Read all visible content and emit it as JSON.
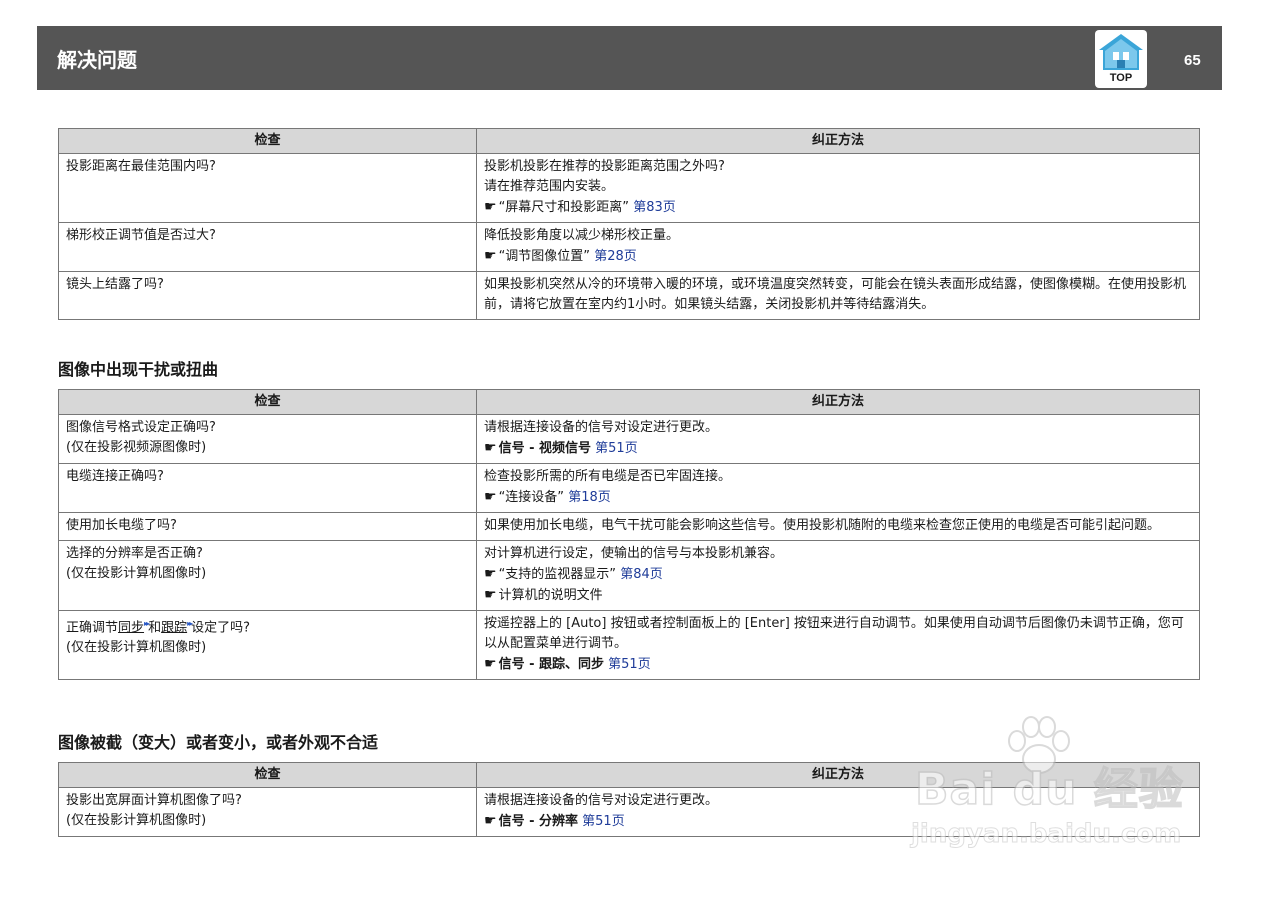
{
  "header": {
    "title": "解决问题",
    "top_label": "TOP",
    "page_number": "65"
  },
  "common": {
    "col_check": "检查",
    "col_fix": "纠正方法"
  },
  "table1": {
    "rows": [
      {
        "check": [
          "投影距离在最佳范围内吗?"
        ],
        "fix": [
          "投影机投影在推荐的投影距离范围之外吗?",
          "请在推荐范围内安装。"
        ],
        "refs": [
          {
            "text": "“屏幕尺寸和投影距离”",
            "page": "第83页"
          }
        ]
      },
      {
        "check": [
          "梯形校正调节值是否过大?"
        ],
        "fix": [
          "降低投影角度以减少梯形校正量。"
        ],
        "refs": [
          {
            "text": "“调节图像位置”",
            "page": "第28页"
          }
        ]
      },
      {
        "check": [
          "镜头上结露了吗?"
        ],
        "fix": [
          "如果投影机突然从冷的环境带入暖的环境，或环境温度突然转变，可能会在镜头表面形成结露，使图像模糊。在使用投影机前，请将它放置在室内约1小时。如果镜头结露，关闭投影机并等待结露消失。"
        ],
        "refs": []
      }
    ]
  },
  "section2": {
    "heading": "图像中出现干扰或扭曲",
    "rows": [
      {
        "check": [
          "图像信号格式设定正确吗?",
          "(仅在投影视频源图像时)"
        ],
        "fix": [
          "请根据连接设备的信号对设定进行更改。"
        ],
        "refs": [
          {
            "text": "信号 - 视频信号",
            "bold": true,
            "page": "第51页"
          }
        ]
      },
      {
        "check": [
          "电缆连接正确吗?"
        ],
        "fix": [
          "检查投影所需的所有电缆是否已牢固连接。"
        ],
        "refs": [
          {
            "text": "“连接设备”",
            "page": "第18页"
          }
        ]
      },
      {
        "check": [
          "使用加长电缆了吗?"
        ],
        "fix": [
          "如果使用加长电缆，电气干扰可能会影响这些信号。使用投影机随附的电缆来检查您正使用的电缆是否可能引起问题。"
        ],
        "refs": []
      },
      {
        "check": [
          "选择的分辨率是否正确?",
          "(仅在投影计算机图像时)"
        ],
        "fix": [
          "对计算机进行设定，使输出的信号与本投影机兼容。"
        ],
        "refs": [
          {
            "text": "“支持的监视器显示”",
            "page": "第84页"
          },
          {
            "text": "计算机的说明文件",
            "page": ""
          }
        ]
      },
      {
        "check_rich": {
          "a": "正确调节",
          "b": "同步",
          "c": "和",
          "d": "跟踪",
          "e": "设定了吗?",
          "marker": "▸▸"
        },
        "check": [
          "(仅在投影计算机图像时)"
        ],
        "fix": [
          "按遥控器上的 [Auto] 按钮或者控制面板上的 [Enter] 按钮来进行自动调节。如果使用自动调节后图像仍未调节正确，您可以从配置菜单进行调节。"
        ],
        "refs": [
          {
            "text": "信号 - 跟踪、同步",
            "bold": true,
            "page": "第51页"
          }
        ]
      }
    ]
  },
  "section3": {
    "heading": "图像被截（变大）或者变小，或者外观不合适",
    "rows": [
      {
        "check": [
          "投影出宽屏面计算机图像了吗?",
          "(仅在投影计算机图像时)"
        ],
        "fix": [
          "请根据连接设备的信号对设定进行更改。"
        ],
        "refs": [
          {
            "text": "信号 - 分辨率",
            "bold": true,
            "page": "第51页"
          }
        ]
      }
    ]
  },
  "watermark": {
    "logo": "Bai du 经验",
    "url": "jingyan.baidu.com"
  },
  "colors": {
    "header_bg": "#555555",
    "table_header_bg": "#d7d7d7",
    "link": "#1f3c99"
  },
  "icons": {
    "ref": "pointing-hand-icon",
    "top": "house-icon"
  }
}
